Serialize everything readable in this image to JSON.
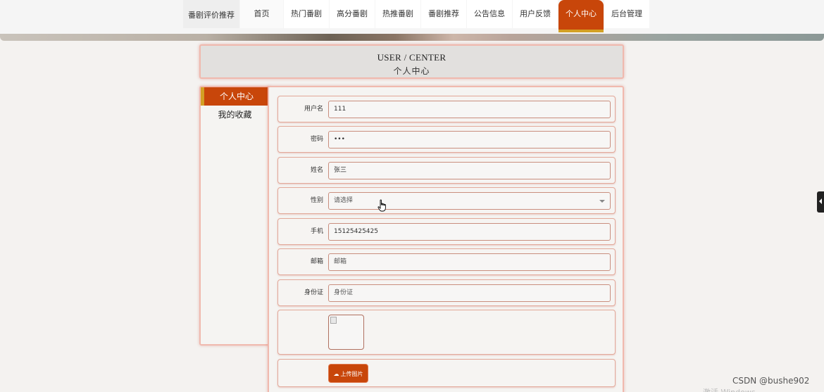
{
  "nav": {
    "brand": "番剧评价推荐",
    "items": [
      {
        "label": "首页"
      },
      {
        "label": "热门番剧"
      },
      {
        "label": "高分番剧"
      },
      {
        "label": "热推番剧"
      },
      {
        "label": "番剧推荐"
      },
      {
        "label": "公告信息"
      },
      {
        "label": "用户反馈"
      },
      {
        "label": "个人中心"
      },
      {
        "label": "后台管理"
      }
    ],
    "active_index": 7,
    "accent": "#c8460a",
    "accent_underline": "#d3a024"
  },
  "hero": {
    "en": "USER / CENTER",
    "cn": "个人中心"
  },
  "side": {
    "items": [
      {
        "label": "个人中心"
      },
      {
        "label": "我的收藏"
      }
    ]
  },
  "form": {
    "username": {
      "label": "用户名",
      "value": "111"
    },
    "password": {
      "label": "密码",
      "value": "•••"
    },
    "name": {
      "label": "姓名",
      "value": "张三"
    },
    "gender": {
      "label": "性别",
      "value": "请选择"
    },
    "phone": {
      "label": "手机",
      "value": "15125425425"
    },
    "email": {
      "label": "邮箱",
      "placeholder": "邮箱"
    },
    "idcard": {
      "label": "身份证",
      "placeholder": "身份证"
    },
    "upload_label": "上传图片"
  },
  "watermark": "CSDN @bushe902",
  "os_notice": "激活 Windows"
}
